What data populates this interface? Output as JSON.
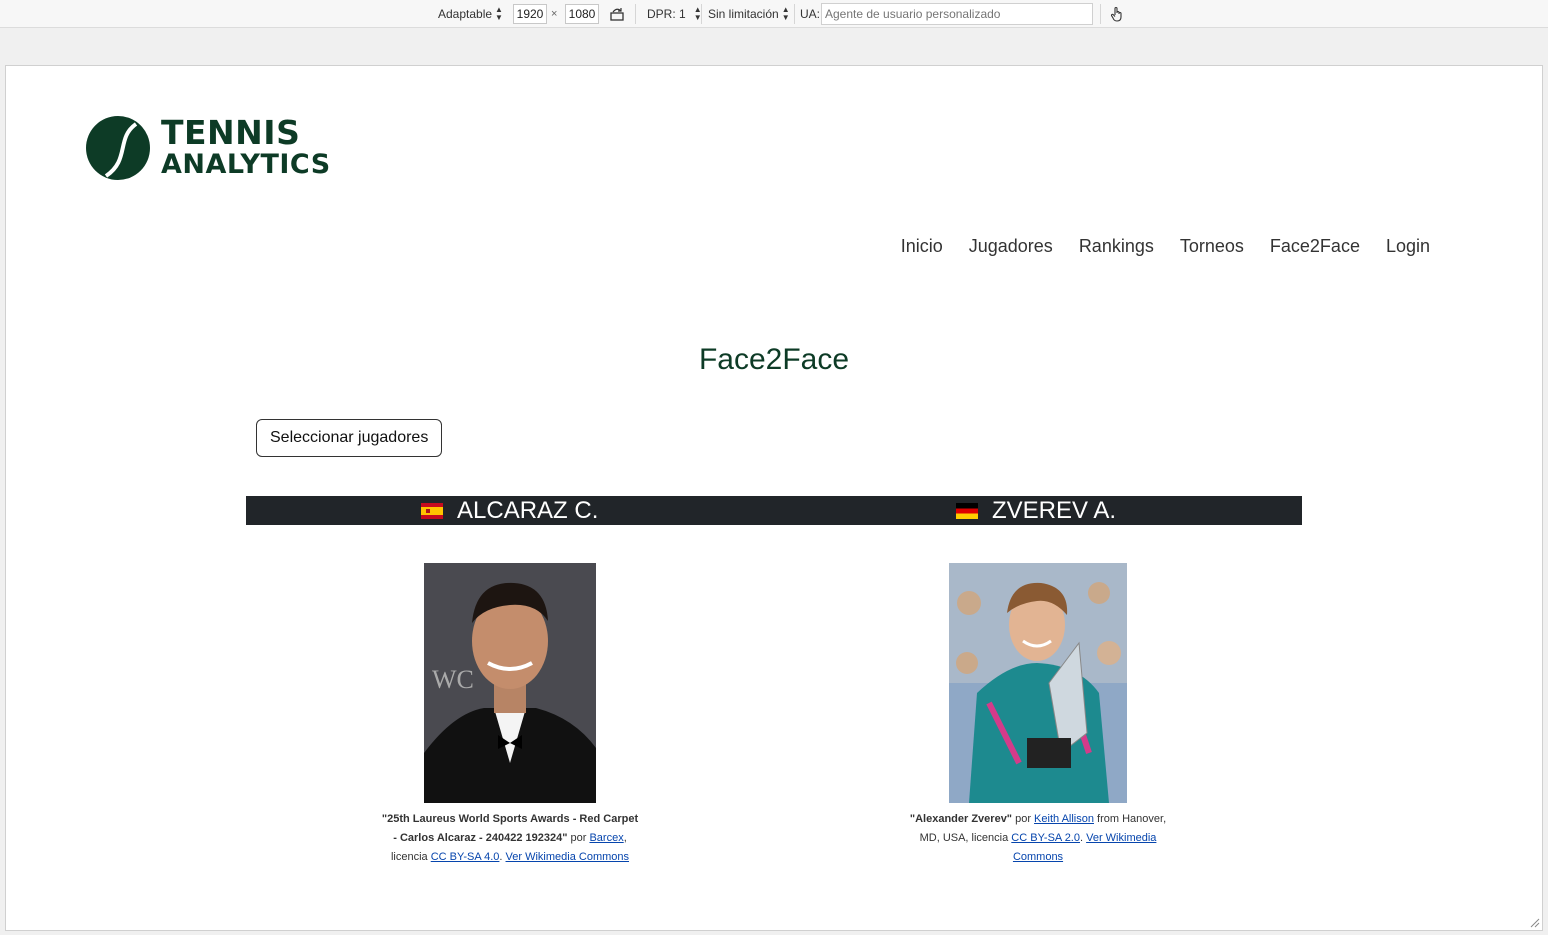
{
  "toolbar": {
    "device": "Adaptable",
    "width": "1920",
    "times": "×",
    "height": "1080",
    "dpr": "DPR: 1",
    "throttle": "Sin limitación",
    "ua_label": "UA:",
    "ua_placeholder": "Agente de usuario personalizado"
  },
  "brand": {
    "line1": "TENNIS",
    "line2": "ANALYTICS",
    "color": "#0d3b26"
  },
  "nav": [
    "Inicio",
    "Jugadores",
    "Rankings",
    "Torneos",
    "Face2Face",
    "Login"
  ],
  "page_title": "Face2Face",
  "select_button": "Seleccionar jugadores",
  "players": [
    {
      "name": "ALCARAZ C.",
      "flag": "spain-flag-icon",
      "caption": {
        "title": "\"25th Laureus World Sports Awards - Red Carpet - Carlos Alcaraz - 240422 192324\"",
        "by": " por ",
        "author": "Barcex",
        "license_prefix": ", licencia ",
        "license": "CC BY-SA 4.0",
        "sep": ". ",
        "source": "Ver Wikimedia Commons"
      }
    },
    {
      "name": "ZVEREV A.",
      "flag": "germany-flag-icon",
      "caption": {
        "title": "\"Alexander Zverev\"",
        "by": " por ",
        "author": "Keith Allison",
        "from": " from Hanover, MD, USA, licencia ",
        "license": "CC BY-SA 2.0",
        "sep": ". ",
        "source": "Ver Wikimedia Commons"
      }
    }
  ],
  "colors": {
    "bar": "#212529",
    "brand": "#0d3b26",
    "link": "#0645ad"
  }
}
